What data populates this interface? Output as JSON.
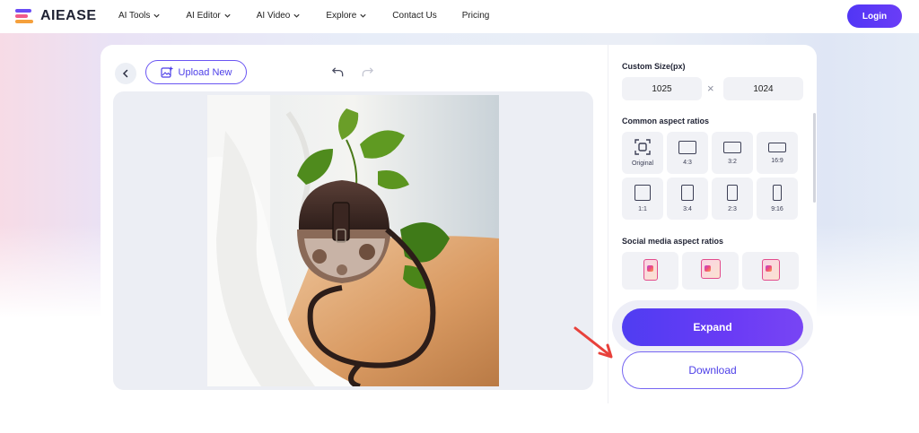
{
  "header": {
    "logo_text": "AIEASE",
    "nav": [
      {
        "label": "AI Tools",
        "dropdown": true
      },
      {
        "label": "AI Editor",
        "dropdown": true
      },
      {
        "label": "AI Video",
        "dropdown": true
      },
      {
        "label": "Explore",
        "dropdown": true
      },
      {
        "label": "Contact Us",
        "dropdown": false
      },
      {
        "label": "Pricing",
        "dropdown": false
      }
    ],
    "login_label": "Login"
  },
  "editor": {
    "upload_label": "Upload New",
    "icons": [
      "back-arrow-icon",
      "image-plus-icon",
      "undo-icon",
      "redo-icon"
    ]
  },
  "panel": {
    "custom_size_title": "Custom Size(px)",
    "width_value": "1025",
    "height_value": "1024",
    "times_symbol": "×",
    "common_title": "Common aspect ratios",
    "ratios": [
      "Original",
      "4:3",
      "3:2",
      "16:9",
      "1:1",
      "3:4",
      "2:3",
      "9:16"
    ],
    "social_title": "Social media aspect ratios"
  },
  "actions": {
    "expand_label": "Expand",
    "download_label": "Download"
  },
  "colors": {
    "accent": "#5136f5",
    "annotation_arrow": "#e8413b"
  }
}
